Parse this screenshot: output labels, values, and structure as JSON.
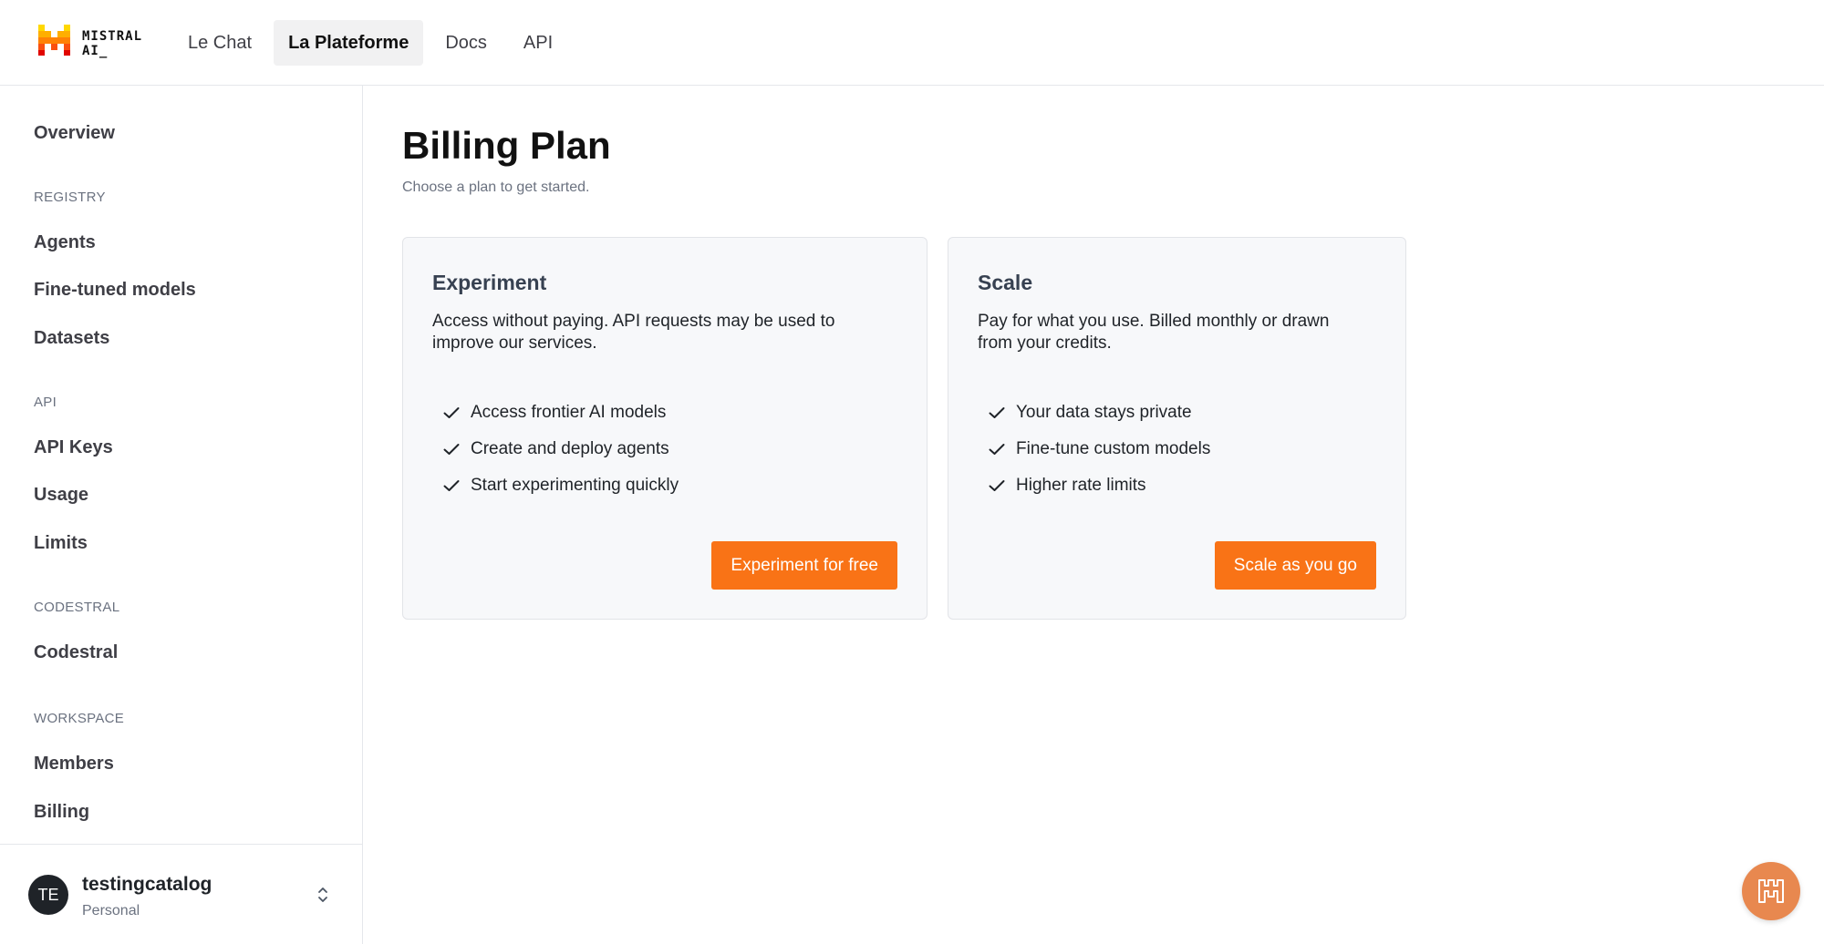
{
  "brand": {
    "name_line1": "MISTRAL",
    "name_line2": "AI_",
    "logo_icon": "mistral-logo-icon"
  },
  "nav": {
    "items": [
      {
        "label": "Le Chat",
        "active": false
      },
      {
        "label": "La Plateforme",
        "active": true
      },
      {
        "label": "Docs",
        "active": false
      },
      {
        "label": "API",
        "active": false
      }
    ]
  },
  "sidebar": {
    "overview": "Overview",
    "sections": [
      {
        "title": "REGISTRY",
        "items": [
          "Agents",
          "Fine-tuned models",
          "Datasets"
        ]
      },
      {
        "title": "API",
        "items": [
          "API Keys",
          "Usage",
          "Limits"
        ]
      },
      {
        "title": "CODESTRAL",
        "items": [
          "Codestral"
        ]
      },
      {
        "title": "WORKSPACE",
        "items": [
          "Members",
          "Billing"
        ]
      }
    ]
  },
  "account": {
    "initials": "TE",
    "name": "testingcatalog",
    "type": "Personal",
    "toggle_icon": "chevron-up-down-icon"
  },
  "main": {
    "title": "Billing Plan",
    "subtitle": "Choose a plan to get started.",
    "plans": [
      {
        "name": "Experiment",
        "description": "Access without paying. API requests may be used to improve our services.",
        "features": [
          "Access frontier AI models",
          "Create and deploy agents",
          "Start experimenting quickly"
        ],
        "button": "Experiment for free"
      },
      {
        "name": "Scale",
        "description": "Pay for what you use. Billed monthly or drawn from your credits.",
        "features": [
          "Your data stays private",
          "Fine-tune custom models",
          "Higher rate limits"
        ],
        "button": "Scale as you go"
      }
    ]
  },
  "help_fab": {
    "icon": "mistral-chat-icon"
  },
  "colors": {
    "accent": "#f97316",
    "fab": "#e8884f",
    "text": "#1f2328",
    "muted": "#6b7280"
  }
}
